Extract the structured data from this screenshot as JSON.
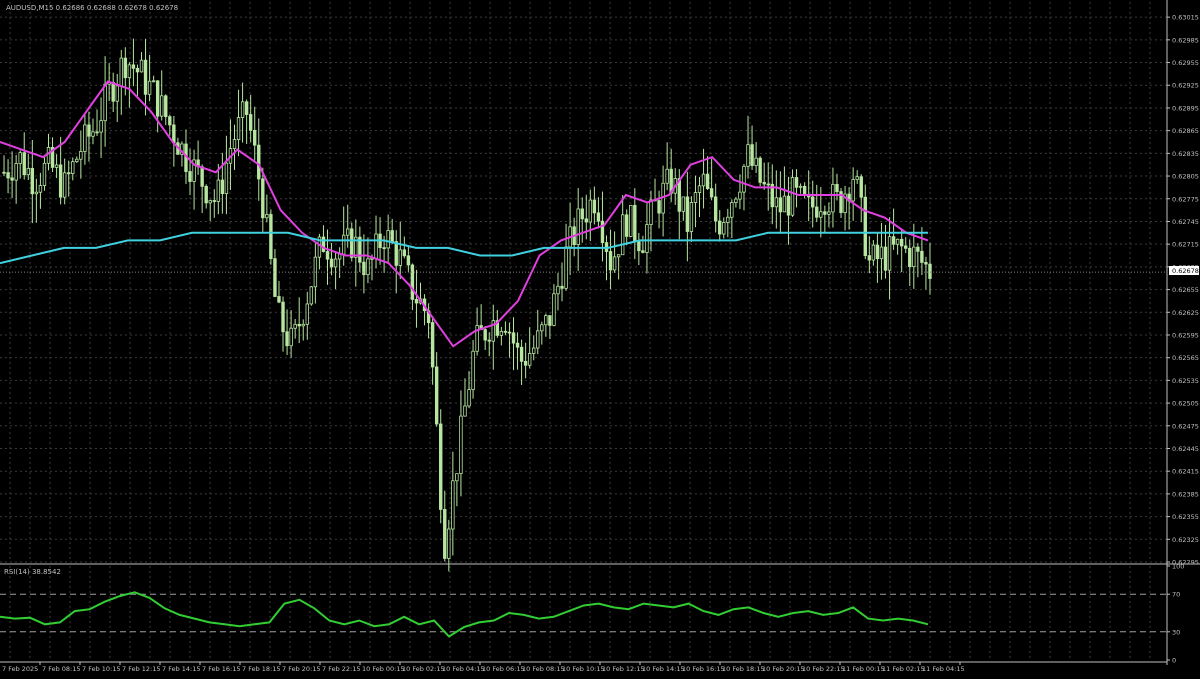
{
  "header": {
    "symbol_line": "AUDUSD,M15  0.62686 0.62688 0.62678 0.62678"
  },
  "rsi_panel": {
    "label": "RSI(14) 38.8542",
    "levels": [
      30,
      70
    ],
    "axis_ticks": [
      "100",
      "70",
      "30",
      "0"
    ]
  },
  "current_price_label": "0.62678",
  "colors": {
    "background": "#000000",
    "grid": "#3a3a3a",
    "axis": "#c0c0c0",
    "candle": "#b6e6a0",
    "ma_fast": "#e040e0",
    "ma_slow": "#40d0e0",
    "rsi_line": "#32cd32"
  },
  "chart_data": [
    {
      "type": "candlestick",
      "title": "AUDUSD,M15",
      "price_axis_ticks": [
        "0.63015",
        "0.62985",
        "0.62955",
        "0.62925",
        "0.62895",
        "0.62865",
        "0.62835",
        "0.62805",
        "0.62775",
        "0.62745",
        "0.62715",
        "0.62685",
        "0.62655",
        "0.62625",
        "0.62595",
        "0.62565",
        "0.62535",
        "0.62505",
        "0.62475",
        "0.62445",
        "0.62415",
        "0.62385",
        "0.62355",
        "0.62325",
        "0.62295"
      ],
      "ylim": [
        0.62295,
        0.63035
      ],
      "x_labels": [
        "7 Feb 2025",
        "7 Feb 08:15",
        "7 Feb 10:15",
        "7 Feb 12:15",
        "7 Feb 14:15",
        "7 Feb 16:15",
        "7 Feb 18:15",
        "7 Feb 20:15",
        "7 Feb 22:15",
        "10 Feb 00:15",
        "10 Feb 02:15",
        "10 Feb 04:15",
        "10 Feb 06:15",
        "10 Feb 08:15",
        "10 Feb 10:15",
        "10 Feb 12:15",
        "10 Feb 14:15",
        "10 Feb 16:15",
        "10 Feb 18:15",
        "10 Feb 20:15",
        "10 Feb 22:15",
        "11 Feb 00:15",
        "11 Feb 02:15",
        "11 Feb 04:15"
      ],
      "close_path": [
        0.6281,
        0.6283,
        0.628,
        0.6282,
        0.6279,
        0.6284,
        0.6287,
        0.6292,
        0.6296,
        0.6294,
        0.6291,
        0.6287,
        0.6283,
        0.628,
        0.6277,
        0.6285,
        0.6289,
        0.6278,
        0.6262,
        0.6258,
        0.6265,
        0.6272,
        0.627,
        0.6272,
        0.6268,
        0.6273,
        0.627,
        0.6265,
        0.6262,
        0.6232,
        0.6245,
        0.6258,
        0.6261,
        0.6262,
        0.6256,
        0.6258,
        0.6262,
        0.627,
        0.6275,
        0.6278,
        0.6269,
        0.6275,
        0.6272,
        0.6277,
        0.628,
        0.6274,
        0.628,
        0.6274,
        0.6278,
        0.6283,
        0.6279,
        0.6276,
        0.6278,
        0.6276,
        0.6278,
        0.6277,
        0.6281,
        0.6269,
        0.627,
        0.6271,
        0.627,
        0.6268
      ],
      "series": [
        {
          "name": "",
          "values": [
            0.6285,
            0.6284,
            0.6283,
            0.6285,
            0.6289,
            0.6293,
            0.6292,
            0.6289,
            0.6285,
            0.6282,
            0.6281,
            0.6284,
            0.6282,
            0.6276,
            0.6273,
            0.6271,
            0.627,
            0.627,
            0.6269,
            0.6266,
            0.6262,
            0.6258,
            0.626,
            0.6261,
            0.6264,
            0.627,
            0.6272,
            0.6273,
            0.6274,
            0.6278,
            0.6277,
            0.6278,
            0.6282,
            0.6283,
            0.628,
            0.6279,
            0.6279,
            0.6278,
            0.6278,
            0.6278,
            0.6276,
            0.6275,
            0.6273,
            0.6272
          ]
        },
        {
          "name": "",
          "values": [
            0.6269,
            0.627,
            0.6271,
            0.6271,
            0.6272,
            0.6272,
            0.6273,
            0.6273,
            0.6273,
            0.6273,
            0.6272,
            0.6272,
            0.6272,
            0.6271,
            0.6271,
            0.627,
            0.627,
            0.6271,
            0.6271,
            0.6271,
            0.6272,
            0.6272,
            0.6272,
            0.6272,
            0.6273,
            0.6273,
            0.6273,
            0.6273,
            0.6273,
            0.6273
          ]
        }
      ]
    },
    {
      "type": "line",
      "title": "RSI(14) 38.8542",
      "ylim": [
        0,
        100
      ],
      "series": [
        {
          "name": "",
          "values": [
            46,
            44,
            45,
            38,
            40,
            52,
            54,
            62,
            68,
            72,
            66,
            55,
            48,
            44,
            40,
            38,
            36,
            38,
            40,
            60,
            64,
            55,
            42,
            38,
            42,
            36,
            38,
            46,
            38,
            42,
            25,
            35,
            40,
            42,
            50,
            48,
            44,
            46,
            52,
            58,
            60,
            56,
            54,
            60,
            58,
            56,
            60,
            52,
            48,
            54,
            56,
            50,
            46,
            50,
            52,
            48,
            50,
            56,
            44,
            42,
            44,
            42,
            38
          ]
        }
      ]
    }
  ]
}
